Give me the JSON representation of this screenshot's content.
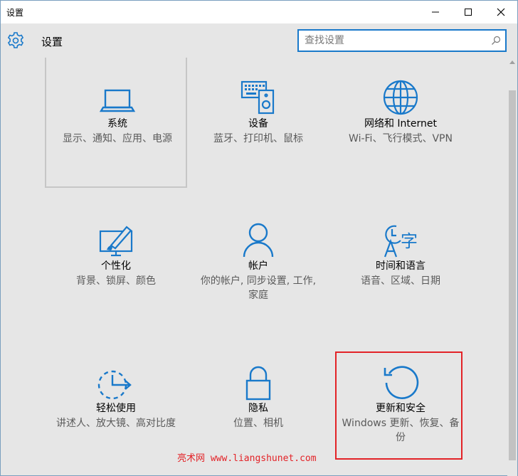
{
  "window": {
    "title": "设置",
    "controls": {
      "minimize": "minimize-icon",
      "maximize": "maximize-icon",
      "close": "close-icon"
    }
  },
  "header": {
    "title": "设置",
    "search": {
      "placeholder": "查找设置",
      "value": ""
    }
  },
  "colors": {
    "accent": "#1979ca",
    "highlight": "#e32227",
    "text_secondary": "#5a5a5a"
  },
  "tiles": [
    {
      "name": "系统",
      "desc": "显示、通知、应用、电源",
      "icon": "laptop-icon"
    },
    {
      "name": "设备",
      "desc": "蓝牙、打印机、鼠标",
      "icon": "devices-icon"
    },
    {
      "name": "网络和 Internet",
      "desc": "Wi-Fi、飞行模式、VPN",
      "icon": "globe-icon"
    },
    {
      "name": "个性化",
      "desc": "背景、锁屏、颜色",
      "icon": "personalization-icon"
    },
    {
      "name": "帐户",
      "desc": "你的帐户, 同步设置, 工作, 家庭",
      "icon": "person-icon"
    },
    {
      "name": "时间和语言",
      "desc": "语音、区域、日期",
      "icon": "time-language-icon"
    },
    {
      "name": "轻松使用",
      "desc": "讲述人、放大镜、高对比度",
      "icon": "ease-of-access-icon"
    },
    {
      "name": "隐私",
      "desc": "位置、相机",
      "icon": "lock-icon"
    },
    {
      "name": "更新和安全",
      "desc": "Windows 更新、恢复、备份",
      "icon": "update-icon"
    }
  ],
  "watermark": {
    "cn": "亮术网",
    "url": "www.liangshunet.com"
  }
}
